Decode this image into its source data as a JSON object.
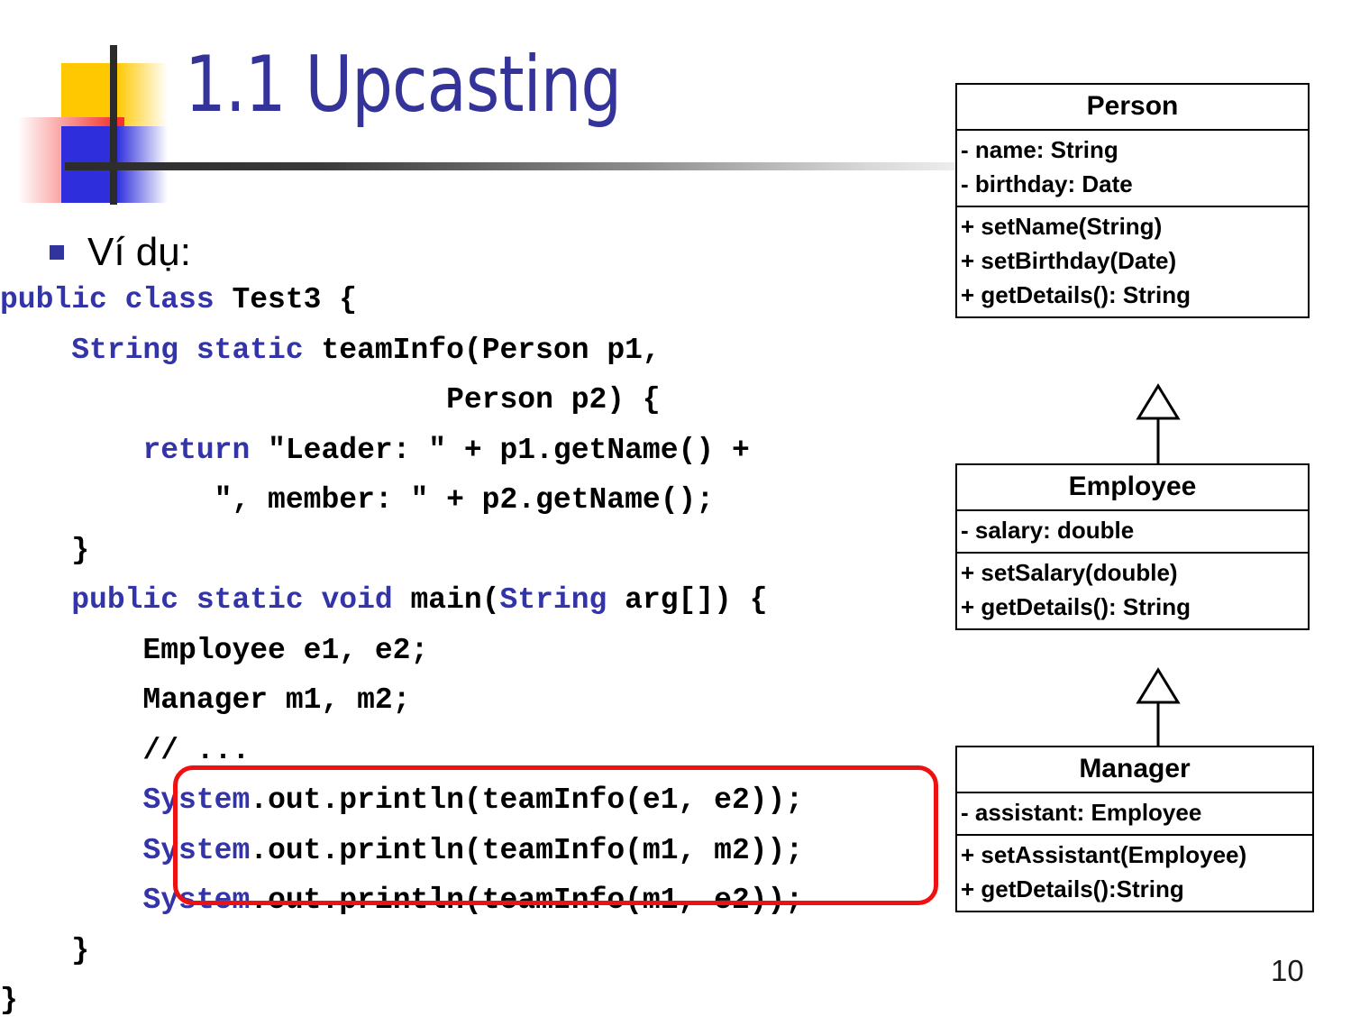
{
  "slide": {
    "title": "1.1 Upcasting",
    "page_number": "10",
    "accent_color": "#333399",
    "highlight_color": "#EE1111",
    "keyword_color": "#3333AA",
    "bullet_color": "#33339E"
  },
  "body": {
    "bullet_label": "Ví dụ:"
  },
  "code": {
    "language": "java",
    "lines": [
      [
        {
          "t": "public class ",
          "k": true
        },
        {
          "t": "Test3 {",
          "k": false
        }
      ],
      [
        {
          "t": "    ",
          "k": false
        },
        {
          "t": "String static ",
          "k": true
        },
        {
          "t": "teamInfo(Person p1,",
          "k": false
        }
      ],
      [
        {
          "t": "                         Person p2) {",
          "k": false
        }
      ],
      [
        {
          "t": "        ",
          "k": false
        },
        {
          "t": "return ",
          "k": true
        },
        {
          "t": "\"Leader: \" + p1.getName() +",
          "k": false
        }
      ],
      [
        {
          "t": "            \", member: \" + p2.getName();",
          "k": false
        }
      ],
      [
        {
          "t": "    }",
          "k": false
        }
      ],
      [
        {
          "t": "    ",
          "k": false
        },
        {
          "t": "public static void ",
          "k": true
        },
        {
          "t": "main(",
          "k": false
        },
        {
          "t": "String ",
          "k": true
        },
        {
          "t": "arg[]) {",
          "k": false
        }
      ],
      [
        {
          "t": "        Employee e1, e2;",
          "k": false
        }
      ],
      [
        {
          "t": "        Manager m1, m2;",
          "k": false
        }
      ],
      [
        {
          "t": "        // ...",
          "k": false
        }
      ],
      [
        {
          "t": "        ",
          "k": false
        },
        {
          "t": "System",
          "k": true
        },
        {
          "t": ".out.println(teamInfo(e1, e2));",
          "k": false
        }
      ],
      [
        {
          "t": "        ",
          "k": false
        },
        {
          "t": "System",
          "k": true
        },
        {
          "t": ".out.println(teamInfo(m1, m2));",
          "k": false
        }
      ],
      [
        {
          "t": "        ",
          "k": false
        },
        {
          "t": "System",
          "k": true
        },
        {
          "t": ".out.println(teamInfo(m1, e2));",
          "k": false
        }
      ],
      [
        {
          "t": "    }",
          "k": false
        }
      ],
      [
        {
          "t": "}",
          "k": false
        }
      ]
    ]
  },
  "uml": {
    "classes": [
      {
        "name": "Person",
        "attributes": [
          "- name: String",
          "- birthday: Date"
        ],
        "operations": [
          "+ setName(String)",
          "+ setBirthday(Date)",
          "+ getDetails(): String"
        ]
      },
      {
        "name": "Employee",
        "attributes": [
          "- salary: double"
        ],
        "operations": [
          "+ setSalary(double)",
          "+ getDetails(): String"
        ]
      },
      {
        "name": "Manager",
        "attributes": [
          "- assistant: Employee"
        ],
        "operations": [
          "+ setAssistant(Employee)",
          "+ getDetails():String"
        ]
      }
    ],
    "relations": [
      {
        "type": "generalization",
        "from": "Employee",
        "to": "Person"
      },
      {
        "type": "generalization",
        "from": "Manager",
        "to": "Employee"
      }
    ]
  }
}
